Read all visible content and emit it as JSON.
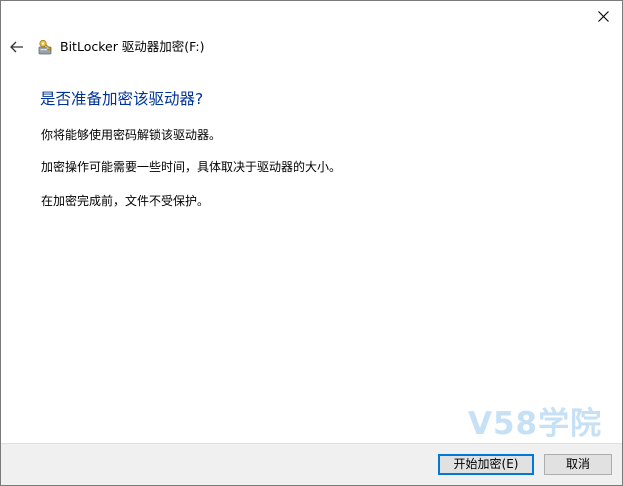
{
  "window": {
    "title": "BitLocker 驱动器加密(F:)",
    "close_label": "✕",
    "back_label": "←"
  },
  "content": {
    "heading": "是否准备加密该驱动器?",
    "paragraphs": [
      "你将能够使用密码解锁该驱动器。",
      "加密操作可能需要一些时间，具体取决于驱动器的大小。",
      "在加密完成前，文件不受保护。"
    ]
  },
  "buttons": {
    "start_label": "开始加密(E)",
    "cancel_label": "取消"
  },
  "watermark": {
    "text": "V58学院"
  },
  "colors": {
    "heading": "#003399",
    "footer_bg": "#f0f0f0",
    "default_button_border": "#0078d7",
    "watermark": "#c6e1f6"
  },
  "icons": {
    "title_icon": "bitlocker-key-drive-icon",
    "back_icon": "back-arrow-icon",
    "close_icon": "close-icon"
  }
}
